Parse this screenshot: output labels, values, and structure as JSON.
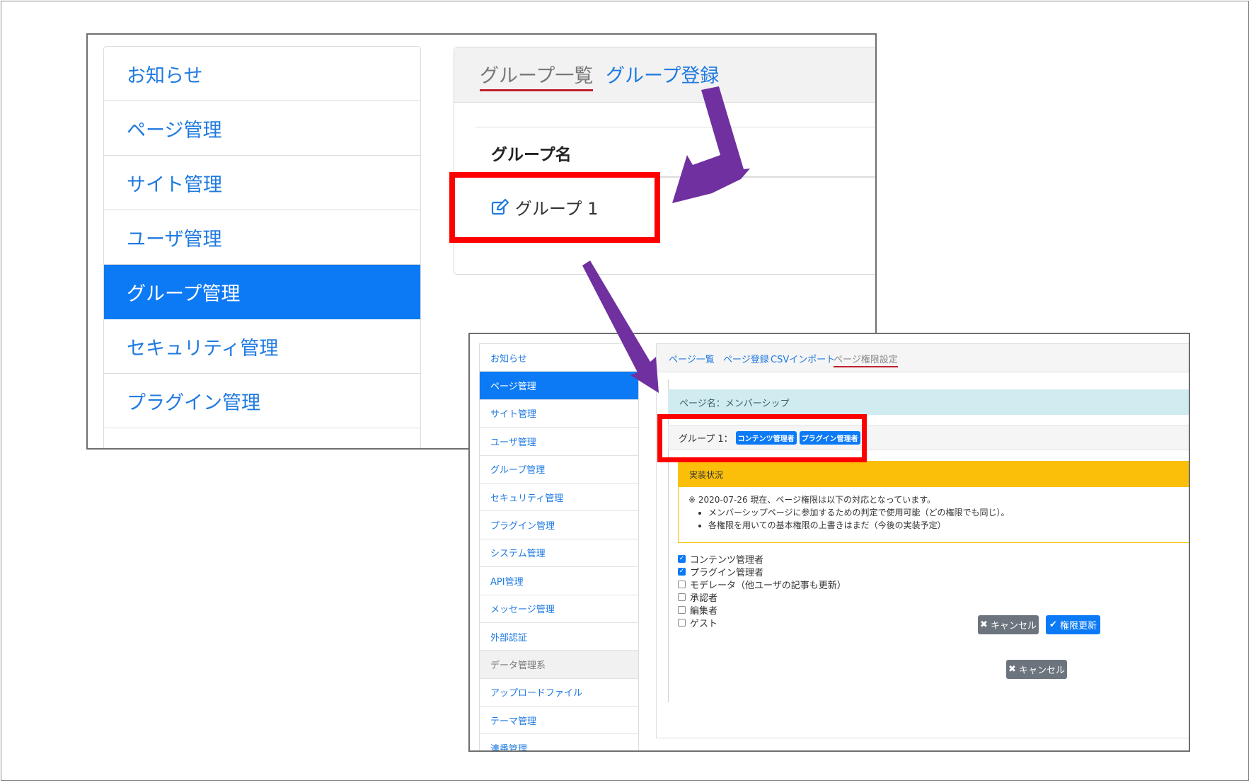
{
  "top_screen": {
    "menu": [
      "お知らせ",
      "ページ管理",
      "サイト管理",
      "ユーザ管理",
      "グループ管理",
      "セキュリティ管理",
      "プラグイン管理"
    ],
    "active_menu": "グループ管理",
    "tabs": {
      "group_list": "グループ一覧",
      "group_register": "グループ登録"
    },
    "table_header": "グループ名",
    "row_name": "グループ 1",
    "row_icon": "edit-icon"
  },
  "bottom_screen": {
    "menu": [
      "お知らせ",
      "ページ管理",
      "サイト管理",
      "ユーザ管理",
      "グループ管理",
      "セキュリティ管理",
      "プラグイン管理",
      "システム管理",
      "API管理",
      "メッセージ管理",
      "外部認証",
      "データ管理系",
      "アップロードファイル",
      "テーマ管理",
      "連番管理"
    ],
    "active_menu": "ページ管理",
    "section_menu": "データ管理系",
    "tabs": [
      "ページ一覧",
      "ページ登録",
      "CSVインポート",
      "ページ権限設定"
    ],
    "current_tab": "ページ権限設定",
    "page_name": "ページ名：メンバーシップ",
    "group_label": "グループ 1：",
    "group_badges": [
      "コンテンツ管理者",
      "プラグイン管理者"
    ],
    "alert_title": "実装状況",
    "alert_note": "※ 2020-07-26 現在、ページ権限は以下の対応となっています。",
    "alert_items": [
      "メンバーシップページに参加するための判定で使用可能（どの権限でも同じ）。",
      "各権限を用いての基本権限の上書きはまだ（今後の実装予定）"
    ],
    "roles": [
      {
        "label": "コンテンツ管理者",
        "checked": true
      },
      {
        "label": "プラグイン管理者",
        "checked": true
      },
      {
        "label": "モデレータ（他ユーザの記事も更新）",
        "checked": false
      },
      {
        "label": "承認者",
        "checked": false
      },
      {
        "label": "編集者",
        "checked": false
      },
      {
        "label": "ゲスト",
        "checked": false
      }
    ],
    "cancel_label": "キャンセル",
    "update_label": "権限更新",
    "cancel_label_2": "キャンセル"
  },
  "colors": {
    "accent": "#0d7af5",
    "highlight": "#ff0000",
    "arrow": "#7030a0",
    "warning": "#fbbf0a",
    "info": "#d1ecf1"
  }
}
